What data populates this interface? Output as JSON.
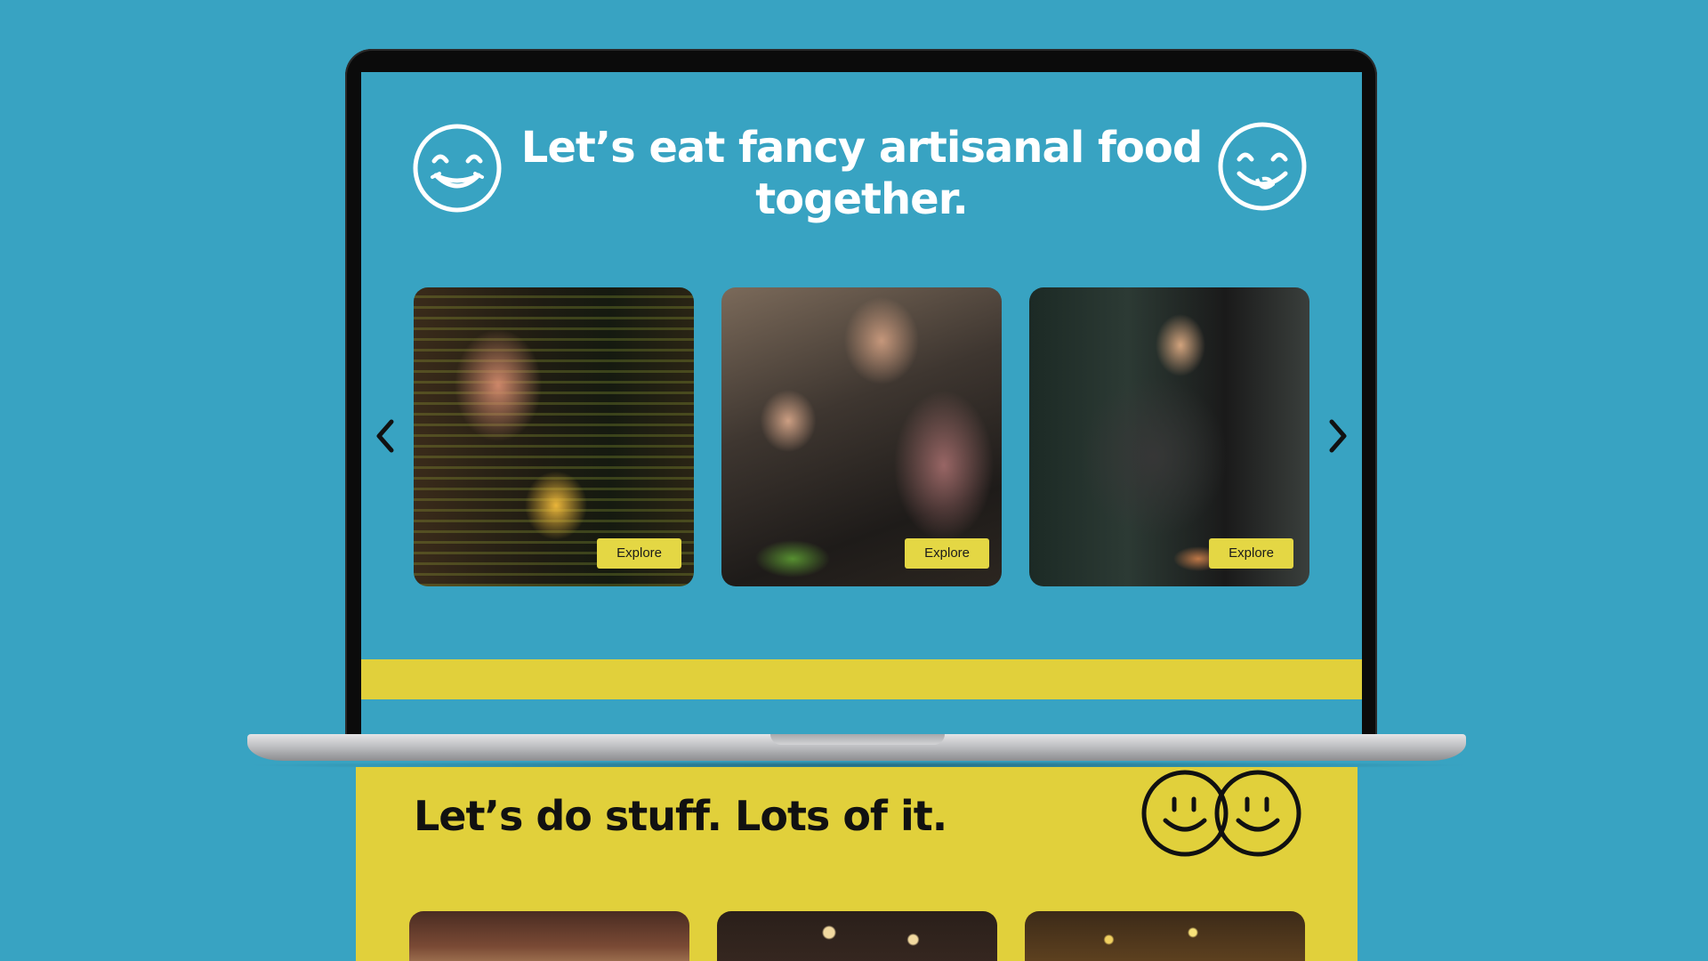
{
  "hero": {
    "title": "Let’s eat fancy artisanal food together."
  },
  "carousel": {
    "cards": [
      {
        "alt": "Woman smiling at a bar holding a glass of beer",
        "button_label": "Explore"
      },
      {
        "alt": "Cooks plating dishes in a busy kitchen",
        "button_label": "Explore"
      },
      {
        "alt": "Chef torching food at a kitchen counter",
        "button_label": "Explore"
      }
    ],
    "prev_icon": "chevron-left-icon",
    "next_icon": "chevron-right-icon"
  },
  "activities": {
    "title": "Let’s do stuff. Lots of it."
  },
  "colors": {
    "background": "#38a3c2",
    "accent_yellow": "#e1d03b",
    "button_yellow": "#e4d744",
    "text_dark": "#111111"
  }
}
